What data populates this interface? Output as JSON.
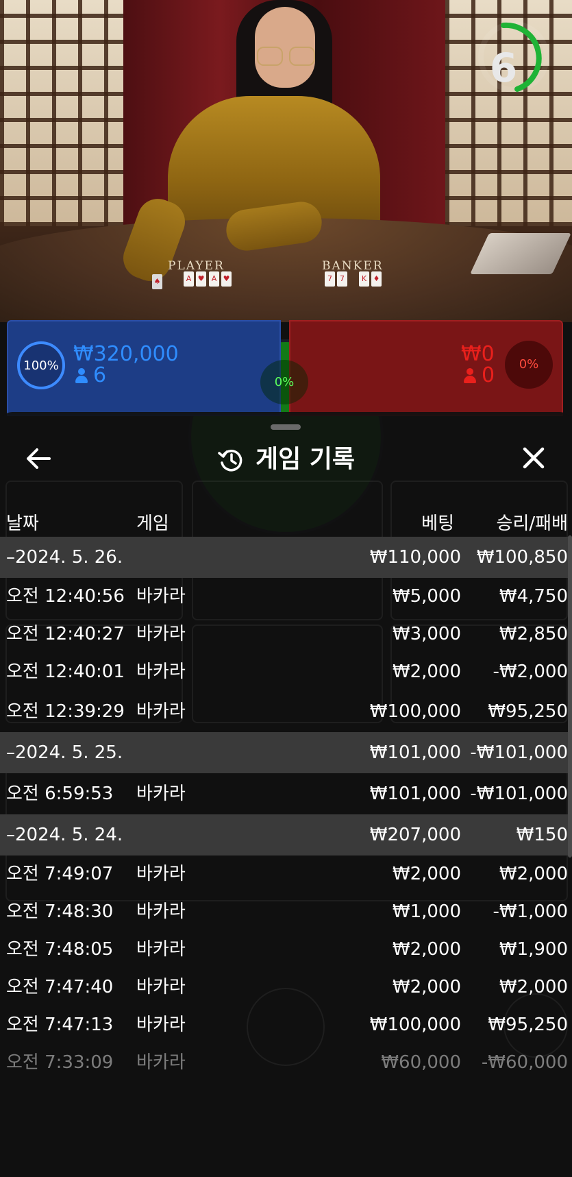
{
  "live_video": {
    "countdown": "6",
    "player_label": "PLAYER",
    "banker_label": "BANKER"
  },
  "betting": {
    "player": {
      "percent": "100%",
      "amount": "₩320,000",
      "count": "6"
    },
    "banker": {
      "percent": "0%",
      "amount": "₩0",
      "count": "0"
    },
    "tie": {
      "percent": "0%"
    }
  },
  "history_sheet": {
    "title": "게임 기록",
    "columns": {
      "date": "날짜",
      "game": "게임",
      "bet": "베팅",
      "result": "승리/패배"
    },
    "rows": [
      {
        "type": "date",
        "label": "–2024. 5. 26.",
        "bet": "₩110,000",
        "result": "₩100,850"
      },
      {
        "type": "entry",
        "time": "오전 12:40:56",
        "game": "바카라",
        "bet": "₩5,000",
        "result": "₩4,750"
      },
      {
        "type": "entry",
        "time": "오전 12:40:27",
        "game": "바카라",
        "bet": "₩3,000",
        "result": "₩2,850"
      },
      {
        "type": "entry",
        "time": "오전 12:40:01",
        "game": "바카라",
        "bet": "₩2,000",
        "result": "-₩2,000"
      },
      {
        "type": "entry",
        "time": "오전 12:39:29",
        "game": "바카라",
        "bet": "₩100,000",
        "result": "₩95,250"
      },
      {
        "type": "date",
        "label": "–2024. 5. 25.",
        "bet": "₩101,000",
        "result": "-₩101,000"
      },
      {
        "type": "entry",
        "time": "오전 6:59:53",
        "game": "바카라",
        "bet": "₩101,000",
        "result": "-₩101,000"
      },
      {
        "type": "date",
        "label": "–2024. 5. 24.",
        "bet": "₩207,000",
        "result": "₩150"
      },
      {
        "type": "entry",
        "time": "오전 7:49:07",
        "game": "바카라",
        "bet": "₩2,000",
        "result": "₩2,000"
      },
      {
        "type": "entry",
        "time": "오전 7:48:30",
        "game": "바카라",
        "bet": "₩1,000",
        "result": "-₩1,000"
      },
      {
        "type": "entry",
        "time": "오전 7:48:05",
        "game": "바카라",
        "bet": "₩2,000",
        "result": "₩1,900"
      },
      {
        "type": "entry",
        "time": "오전 7:47:40",
        "game": "바카라",
        "bet": "₩2,000",
        "result": "₩2,000"
      },
      {
        "type": "entry",
        "time": "오전 7:47:13",
        "game": "바카라",
        "bet": "₩100,000",
        "result": "₩95,250"
      },
      {
        "type": "entry",
        "time": "오전 7:33:09",
        "game": "바카라",
        "bet": "₩60,000",
        "result": "-₩60,000",
        "faded": true
      }
    ]
  },
  "colors": {
    "player_blue": "#2f8dff",
    "banker_red": "#e9201c",
    "tie_green": "#137a17",
    "timer_green": "#1fb336",
    "date_row_bg": "#3a3a3a"
  },
  "icons": [
    "history-icon",
    "back-arrow-icon",
    "close-icon",
    "person-icon"
  ]
}
